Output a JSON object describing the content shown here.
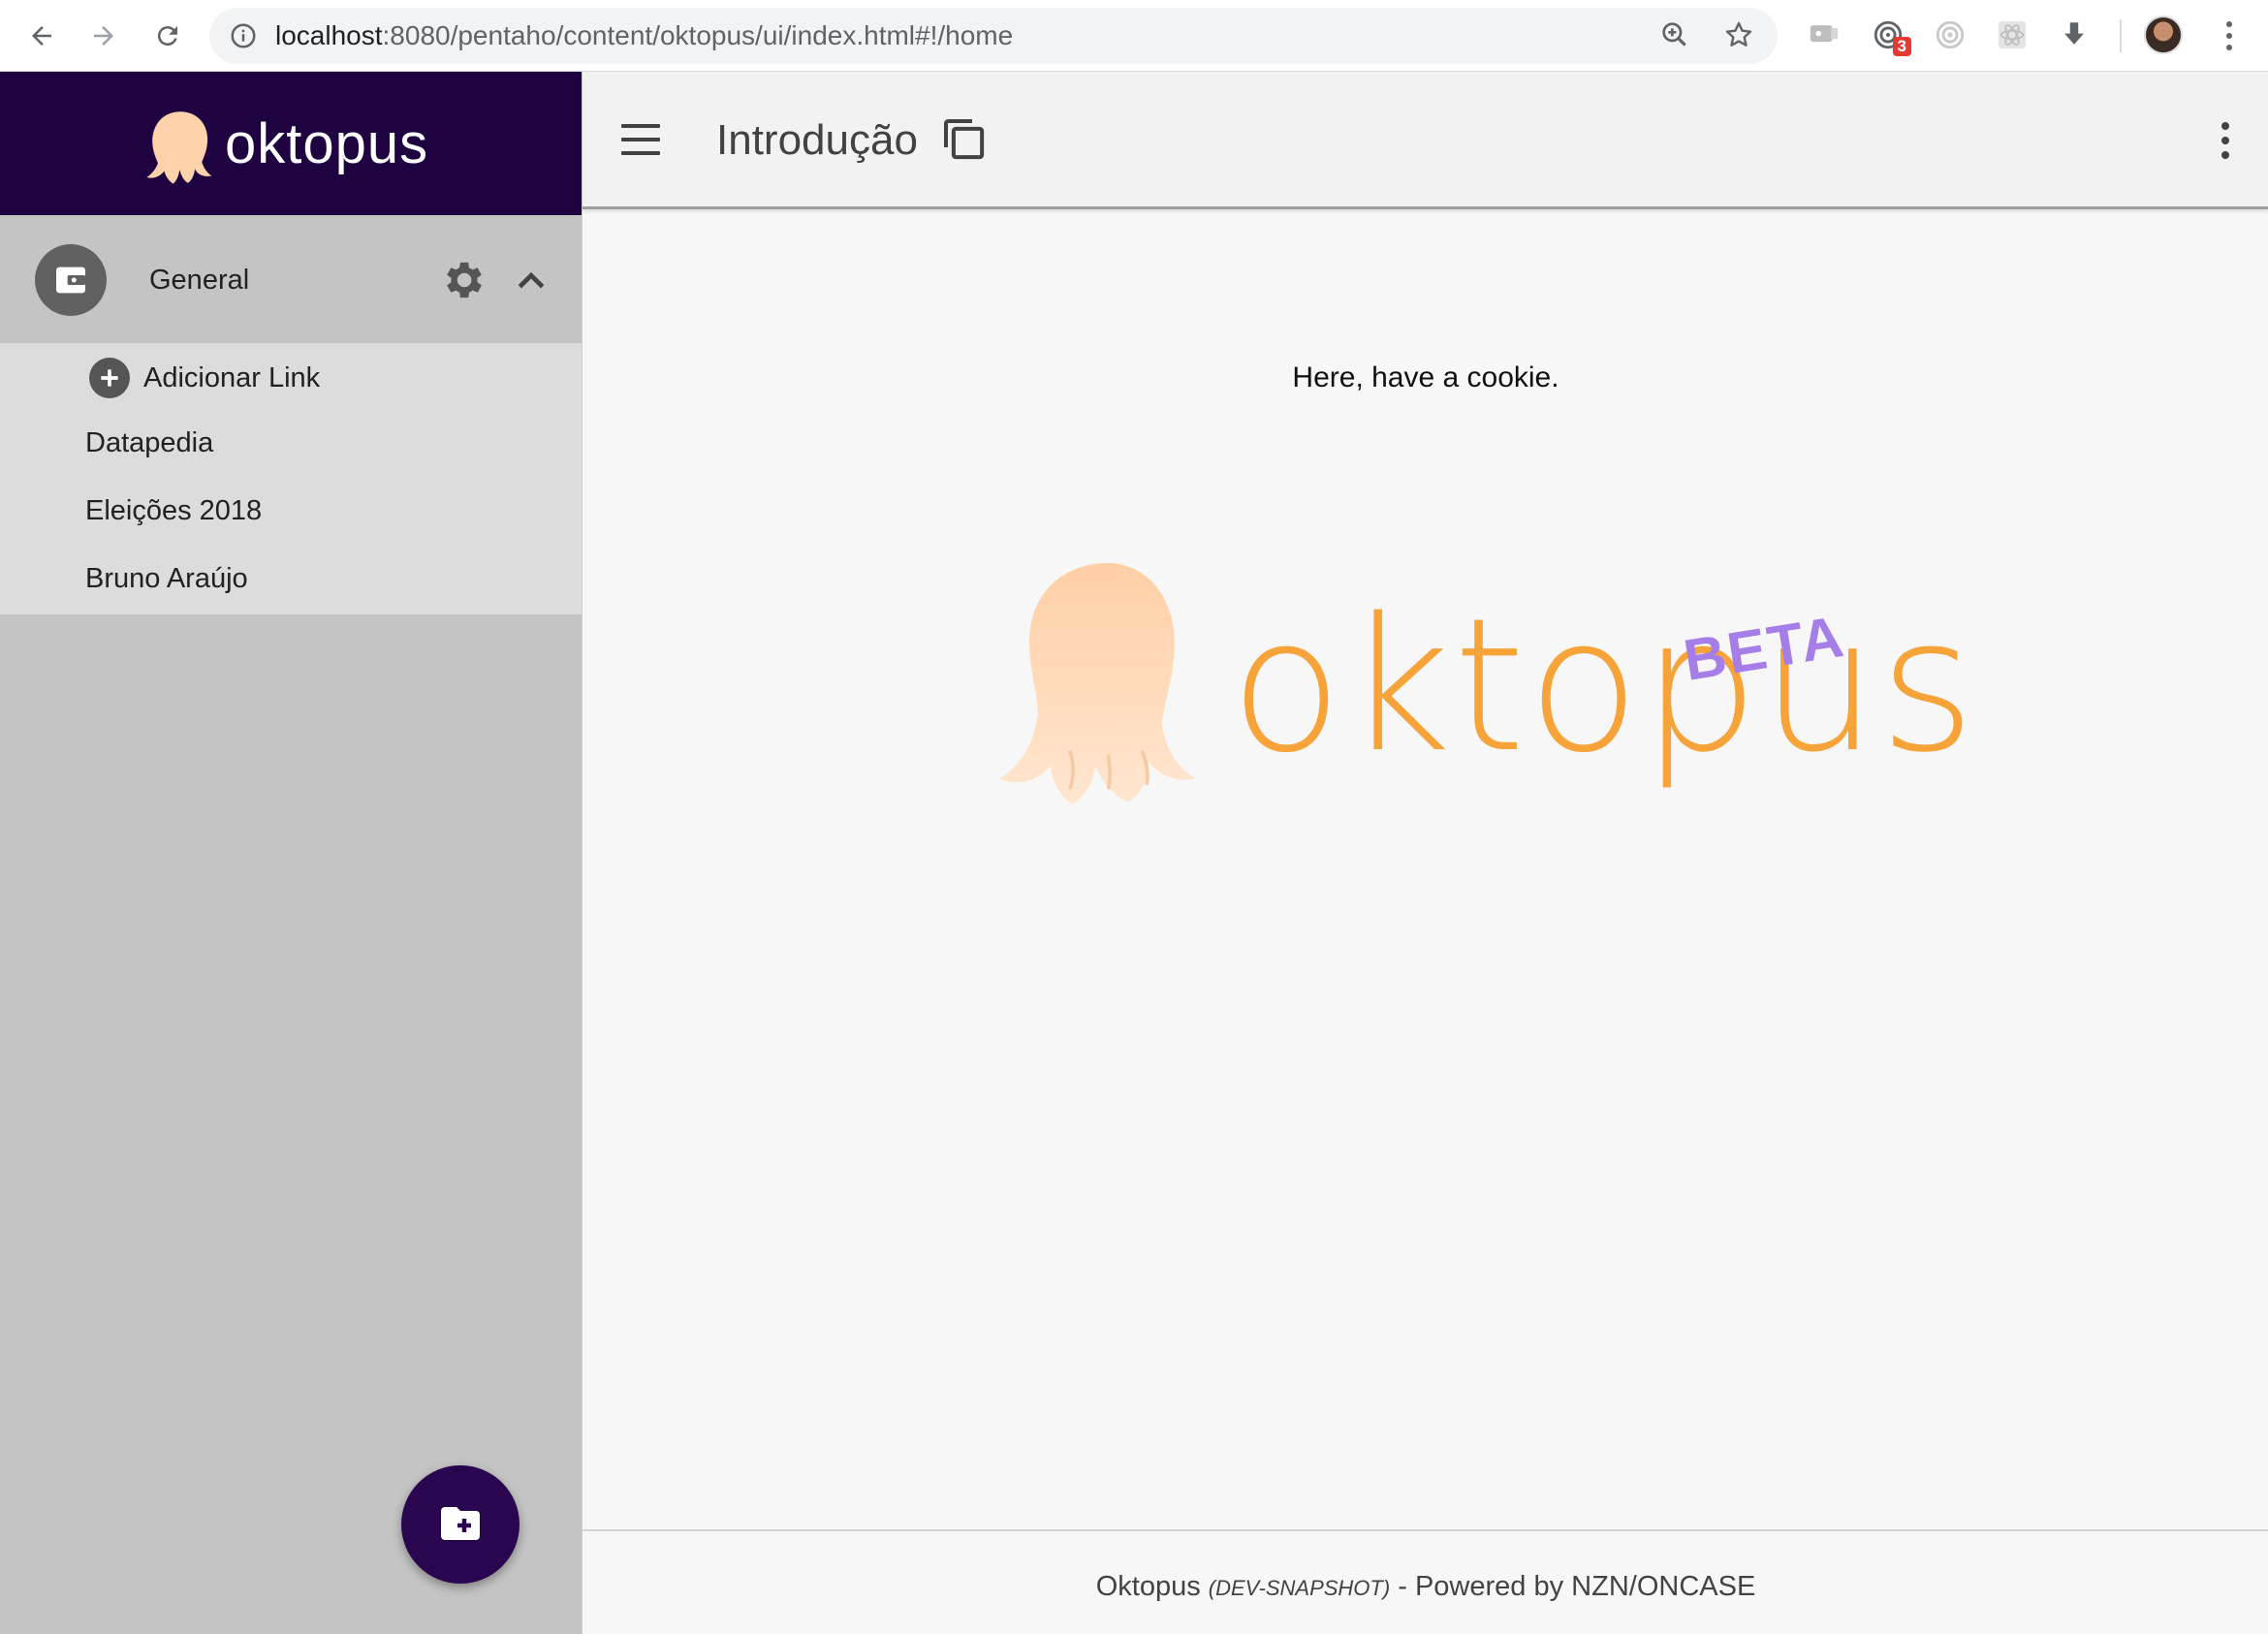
{
  "browser": {
    "url_host": "localhost",
    "url_rest": ":8080/pentaho/content/oktopus/ui/index.html#!/home",
    "extension_badge": "3"
  },
  "sidebar": {
    "brand_name": "oktopus",
    "group": {
      "title": "General"
    },
    "add_link_label": "Adicionar Link",
    "links": [
      "Datapedia",
      "Eleições 2018",
      "Bruno Araújo"
    ]
  },
  "toolbar": {
    "title": "Introdução"
  },
  "main": {
    "greeting": "Here, have a cookie.",
    "hero_name": "oktopus",
    "hero_badge": "BETA"
  },
  "footer": {
    "app_name": "Oktopus",
    "version": "(DEV-SNAPSHOT)",
    "powered_by": "- Powered by NZN/ONCASE"
  },
  "colors": {
    "brand_dark": "#1f0340",
    "fab": "#2a0550",
    "logo_orange": "#f6a43a",
    "octopus_peach": "#ffd2ab",
    "beta_purple": "#a67ee8",
    "sidebar_bg": "#c4c4c4"
  },
  "icons": {
    "back": "arrow-left-icon",
    "forward": "arrow-right-icon",
    "reload": "reload-icon",
    "info": "info-icon",
    "zoom": "zoom-in-icon",
    "star": "star-icon",
    "menu": "hamburger-icon",
    "copy": "copy-icon",
    "more": "more-vert-icon",
    "settings": "gear-icon",
    "collapse": "chevron-up-icon",
    "add": "plus-circle-icon",
    "new_folder": "folder-plus-icon"
  }
}
